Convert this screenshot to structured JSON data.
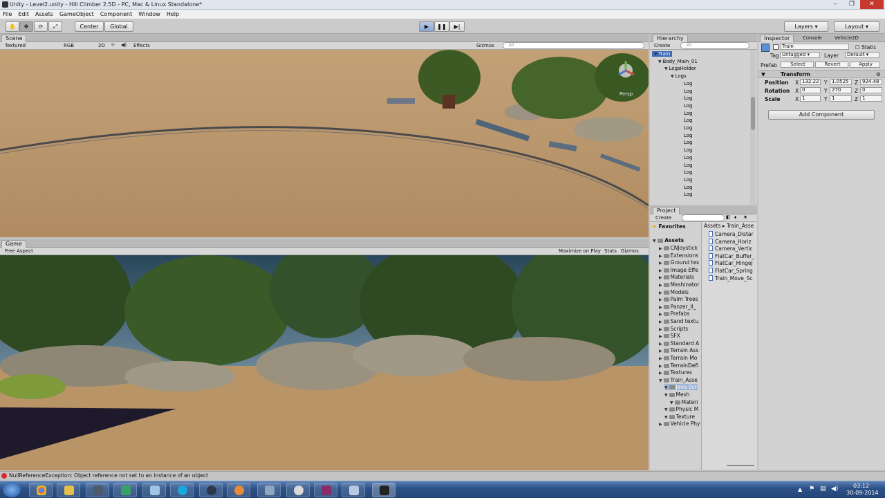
{
  "window": {
    "title": "Unity - Level2.unity - Hill Climber 2.5D - PC, Mac & Linux Standalone*"
  },
  "menu": [
    "File",
    "Edit",
    "Assets",
    "GameObject",
    "Component",
    "Window",
    "Help"
  ],
  "toolbar": {
    "center": "Center",
    "global": "Global",
    "layers": "Layers",
    "layout": "Layout"
  },
  "scene": {
    "tab": "Scene",
    "shading": "Textured",
    "rgb": "RGB",
    "mode2d": "2D",
    "effects": "Effects",
    "gizmos": "Gizmos",
    "search_placeholder": "All",
    "persp": "Persp"
  },
  "game": {
    "tab": "Game",
    "aspect": "Free Aspect",
    "maximize": "Maximize on Play",
    "stats": "Stats",
    "gizmos": "Gizmos"
  },
  "hierarchy": {
    "tab": "Hierarchy",
    "create": "Create",
    "search_placeholder": "All",
    "items": [
      {
        "label": "Train",
        "indent": 0
      },
      {
        "label": "Body_Main_01",
        "indent": 1
      },
      {
        "label": "LogsHolder",
        "indent": 2
      },
      {
        "label": "Logs",
        "indent": 3
      },
      {
        "label": "Log",
        "indent": 4
      },
      {
        "label": "Log",
        "indent": 4
      },
      {
        "label": "Log",
        "indent": 4
      },
      {
        "label": "Log",
        "indent": 4
      },
      {
        "label": "Log",
        "indent": 4
      },
      {
        "label": "Log",
        "indent": 4
      },
      {
        "label": "Log",
        "indent": 4
      },
      {
        "label": "Log",
        "indent": 4
      },
      {
        "label": "Log",
        "indent": 4
      },
      {
        "label": "Log",
        "indent": 4
      },
      {
        "label": "Log",
        "indent": 4
      },
      {
        "label": "Log",
        "indent": 4
      },
      {
        "label": "Log",
        "indent": 4
      },
      {
        "label": "Log",
        "indent": 4
      },
      {
        "label": "Log",
        "indent": 4
      },
      {
        "label": "Log",
        "indent": 4
      }
    ]
  },
  "project": {
    "tab": "Project",
    "create": "Create",
    "favorites": "Favorites",
    "assets_root": "Assets",
    "breadcrumb": [
      "Assets",
      "Train_Asse"
    ],
    "folders": [
      {
        "label": "CNJoystick",
        "indent": 1
      },
      {
        "label": "Extensions",
        "indent": 1
      },
      {
        "label": "Ground tex",
        "indent": 1
      },
      {
        "label": "Image Effe",
        "indent": 1
      },
      {
        "label": "Materials",
        "indent": 1
      },
      {
        "label": "Meshinator",
        "indent": 1
      },
      {
        "label": "Models",
        "indent": 1
      },
      {
        "label": "Palm Trees",
        "indent": 1
      },
      {
        "label": "Panzer_II_",
        "indent": 1
      },
      {
        "label": "Prefabs",
        "indent": 1
      },
      {
        "label": "Sand textu",
        "indent": 1
      },
      {
        "label": "Scripts",
        "indent": 1
      },
      {
        "label": "SFX",
        "indent": 1
      },
      {
        "label": "Standard A",
        "indent": 1
      },
      {
        "label": "Terrain Ass",
        "indent": 1
      },
      {
        "label": "Terrain Mo",
        "indent": 1
      },
      {
        "label": "TerrainDefi",
        "indent": 1
      },
      {
        "label": "Textures",
        "indent": 1
      },
      {
        "label": "Train_Asse",
        "indent": 1
      },
      {
        "label": "Java Scri",
        "indent": 2
      },
      {
        "label": "Mesh",
        "indent": 2
      },
      {
        "label": "Materi",
        "indent": 3
      },
      {
        "label": "Physic M",
        "indent": 2
      },
      {
        "label": "Texture",
        "indent": 2
      },
      {
        "label": "Vehicle Phy",
        "indent": 1
      }
    ],
    "files": [
      "Camera_Distar",
      "Camera_Horiz",
      "Camera_Vertic",
      "FlatCar_Buffer_",
      "FlatCar_HingeJ",
      "FlatCar_Spring",
      "Train_Move_Sc"
    ]
  },
  "inspector": {
    "tabs": [
      "Inspector",
      "Console",
      "Vehicle2D"
    ],
    "object_name": "Train",
    "static": "Static",
    "tag_label": "Tag",
    "tag_value": "Untagged",
    "layer_label": "Layer",
    "layer_value": "Default",
    "prefab_label": "Prefab",
    "select": "Select",
    "revert": "Revert",
    "apply": "Apply",
    "transform": "Transform",
    "position": {
      "label": "Position",
      "x": "132.22",
      "y": "1.0525",
      "z": "924.48"
    },
    "rotation": {
      "label": "Rotation",
      "x": "0",
      "y": "270",
      "z": "0"
    },
    "scale": {
      "label": "Scale",
      "x": "1",
      "y": "1",
      "z": "1"
    },
    "add_component": "Add Component"
  },
  "status": {
    "error": "NullReferenceException: Object reference not set to an instance of an object"
  },
  "taskbar": {
    "time": "03:12",
    "date": "30-09-2014"
  },
  "colors": {
    "sand": "#b9946a",
    "sky": "#3a5466",
    "accent_blue": "#3d6ab6",
    "error_red": "#d62a2a"
  }
}
